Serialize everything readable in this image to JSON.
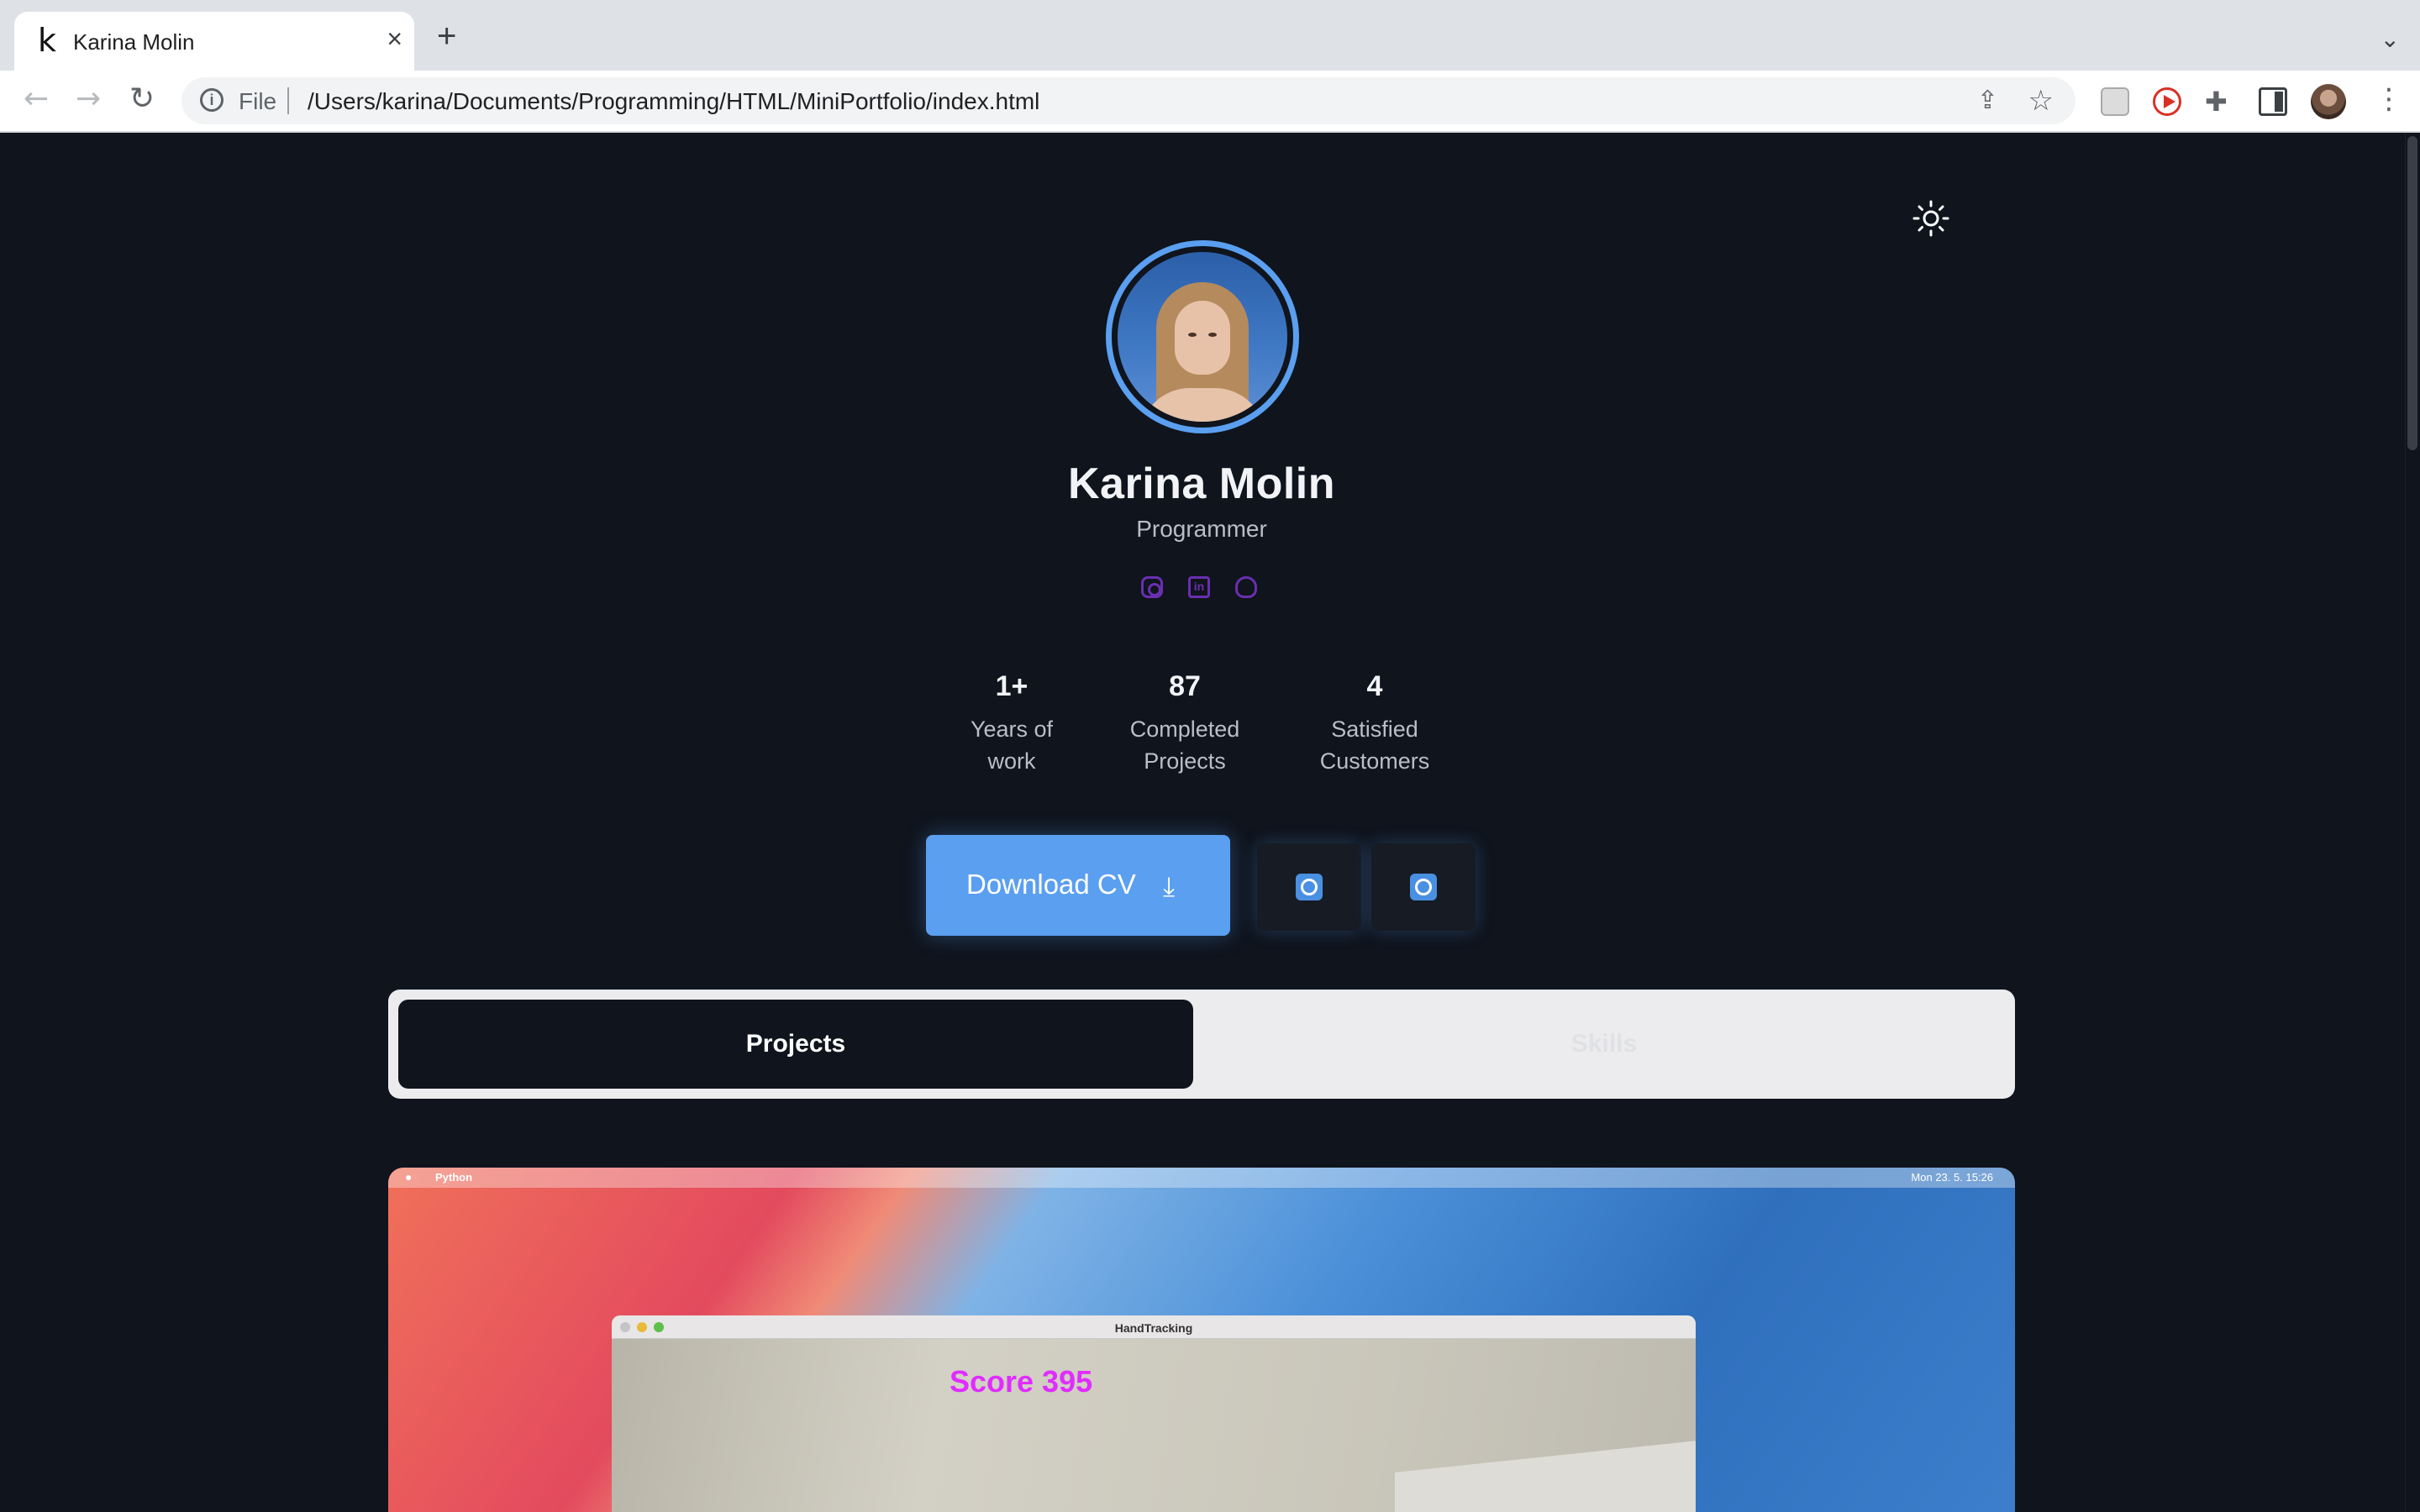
{
  "browser": {
    "tab_title": "Karina Molin",
    "tab_favicon": "k",
    "tab_close": "×",
    "new_tab": "+",
    "tab_list": "⌄",
    "omnibox_scheme": "File",
    "omnibox_url": "/Users/karina/Documents/Programming/HTML/MiniPortfolio/index.html",
    "nav": {
      "back": "←",
      "forward": "→",
      "reload": "↻"
    },
    "menu": "⋮"
  },
  "profile": {
    "name": "Karina Molin",
    "role": "Programmer",
    "socials": [
      "instagram-icon",
      "linkedin-icon",
      "github-icon"
    ]
  },
  "stats": [
    {
      "value": "1+",
      "label_line1": "Years of",
      "label_line2": "work"
    },
    {
      "value": "87",
      "label_line1": "Completed",
      "label_line2": "Projects"
    },
    {
      "value": "4",
      "label_line1": "Satisfied",
      "label_line2": "Customers"
    }
  ],
  "actions": {
    "download_label": "Download CV",
    "download_icon": "⤓",
    "whatsapp_icon": "whatsapp-icon",
    "messenger_icon": "messenger-icon"
  },
  "tabs": {
    "projects": "Projects",
    "skills": "Skills"
  },
  "project": {
    "menubar_app": "Python",
    "menubar_clock": "Mon 23. 5.  15:26",
    "window_title": "HandTracking",
    "score_text": "Score 395"
  },
  "colors": {
    "accent": "#5a9ff0",
    "background": "#0f141d",
    "social_icons": "#6a2fb0"
  }
}
